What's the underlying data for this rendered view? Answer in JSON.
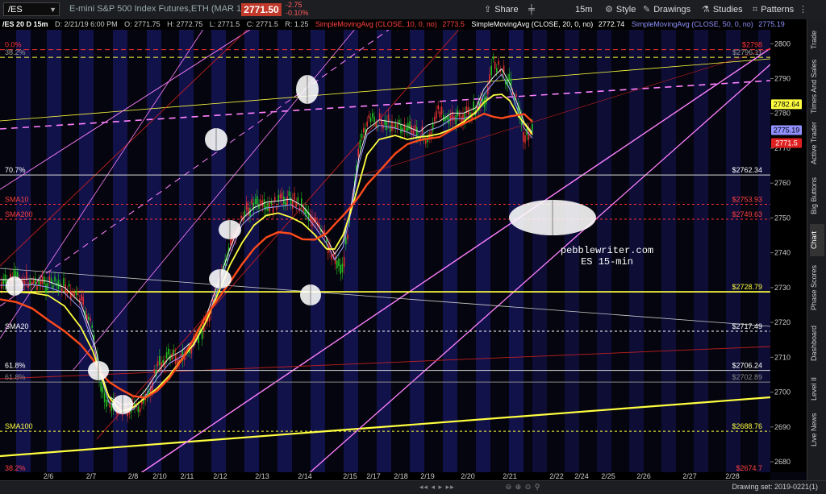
{
  "toolbar": {
    "symbol": "/ES",
    "description": "E-mini S&P 500 Index Futures,ETH (MAR 19)",
    "last_price": "2771.50",
    "change": "-2.75",
    "change_pct": "-0.10%",
    "share": "Share",
    "interval": "15m",
    "style": "Style",
    "drawings": "Drawings",
    "studies": "Studies",
    "patterns": "Patterns"
  },
  "header": {
    "title": "/ES 20 D 15m",
    "date": "D: 2/21/19 6:00 PM",
    "open": "O: 2771.75",
    "high": "H: 2772.75",
    "low": "L: 2771.5",
    "close": "C: 2771.5",
    "range": "R: 1.25",
    "sma10": "SimpleMovingAvg (CLOSE, 10, 0, no)",
    "sma10_val": "2773.5",
    "sma20": "SimpleMovingAvg (CLOSE, 20, 0, no)",
    "sma20_val": "2772.74",
    "sma50": "SimpleMovingAvg (CLOSE, 50, 0, no)",
    "sma50_val": "2775.19"
  },
  "colors": {
    "sma10": "#ff4040",
    "sma20": "#ffffff",
    "sma50": "#9090ff",
    "yellow": "#ffff40",
    "magenta": "#ff80ff",
    "red": "#ff3030",
    "orange": "#ff4a1a",
    "down": "#e03030",
    "up": "#20c020"
  },
  "price_axis": {
    "min": 2677,
    "max": 2804,
    "ticks": [
      "2800",
      "2790",
      "2780",
      "2770",
      "2760",
      "2750",
      "2740",
      "2730",
      "2720",
      "2710",
      "2700",
      "2690",
      "2680"
    ],
    "tags": [
      {
        "value": "2782.64",
        "price": 2782.64,
        "bg": "#ffff40",
        "fg": "#000"
      },
      {
        "value": "2775.19",
        "price": 2775.19,
        "bg": "#9090ff",
        "fg": "#000"
      },
      {
        "value": "2771.5",
        "price": 2771.5,
        "bg": "#e02020",
        "fg": "#fff"
      }
    ]
  },
  "date_axis": {
    "labels": [
      "2/6",
      "2/7",
      "2/8",
      "2/10",
      "2/11",
      "2/12",
      "2/13",
      "2/14",
      "2/15",
      "2/17",
      "2/18",
      "2/19",
      "2/20",
      "2/21",
      "2/22",
      "2/24",
      "2/25",
      "2/26",
      "2/27",
      "2/28"
    ]
  },
  "level_lines": [
    {
      "left_label": "70.7%",
      "right_label": "$2762.34",
      "price": 2762.34,
      "color": "#dddddd",
      "label_color": "#ffffff",
      "dash": ""
    },
    {
      "left_label": "SMA10",
      "right_label": "$2753.93",
      "price": 2753.93,
      "color": "#ff3030",
      "label_color": "#ff4040",
      "dash": "3,3"
    },
    {
      "left_label": "SMA200",
      "right_label": "$2749.63",
      "price": 2749.63,
      "color": "#ff3030",
      "label_color": "#ff4040",
      "dash": "3,3"
    },
    {
      "left_label": "",
      "right_label": "$2728.79",
      "price": 2728.79,
      "color": "#ffff40",
      "label_color": "#ffff40",
      "dash": ""
    },
    {
      "left_label": "SMA20",
      "right_label": "$2717.49",
      "price": 2717.49,
      "color": "#ffffff",
      "label_color": "#ffffff",
      "dash": "3,3"
    },
    {
      "left_label": "61.8%",
      "right_label": "$2706.24",
      "price": 2706.24,
      "color": "#dddddd",
      "label_color": "#ffffff",
      "dash": ""
    },
    {
      "left_label": "61.8%",
      "right_label": "$2702.89",
      "price": 2702.89,
      "color": "#888888",
      "label_color": "#888888",
      "dash": ""
    },
    {
      "left_label": "SMA100",
      "right_label": "$2688.76",
      "price": 2688.76,
      "color": "#ffff40",
      "label_color": "#ffff40",
      "dash": "3,3"
    },
    {
      "left_label": "38.2%",
      "right_label": "$2674.7",
      "price": 2676.8,
      "color": "#ff3030",
      "label_color": "#ff4040",
      "dash": ""
    },
    {
      "left_label": "0.0%",
      "right_label": "$2798",
      "price": 2798.3,
      "color": "#ff3030",
      "label_color": "#ff3030",
      "dash": "6,4"
    },
    {
      "left_label": "38.2%",
      "right_label": "$2796.11",
      "price": 2796.11,
      "color": "#ffff40",
      "label_color": "#999999",
      "dash": "6,4"
    }
  ],
  "watermark": {
    "line1": "pebblewriter.com",
    "line2": "ES 15-min"
  },
  "side_tabs": [
    "Trade",
    "Times And Sales",
    "Active Trader",
    "Big Buttons",
    "Chart",
    "Phase Scores",
    "Dashboard",
    "Level II",
    "Live News"
  ],
  "footer": {
    "drawing_set": "Drawing set: 2019-0221(1)"
  }
}
